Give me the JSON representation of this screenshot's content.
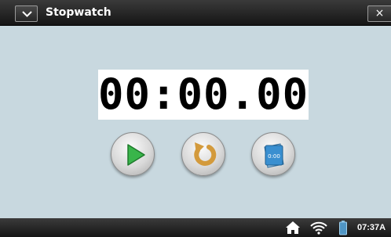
{
  "window": {
    "title": "Stopwatch",
    "menu_icon": "chevron-down-icon",
    "close_label": "×"
  },
  "stopwatch": {
    "time": "00:00.00",
    "buttons": {
      "start_icon": "play-icon",
      "reset_icon": "reset-icon",
      "lap_icon": "lap-icon",
      "lap_label": "0:00"
    }
  },
  "status_bar": {
    "icons": [
      "home-icon",
      "wifi-icon",
      "battery-icon"
    ],
    "clock": "07:37A"
  },
  "colors": {
    "background": "#c8d8df",
    "display": "#ffffff",
    "play": "#39b54a",
    "reset": "#d39a3c",
    "lap": "#3a8fd0"
  }
}
